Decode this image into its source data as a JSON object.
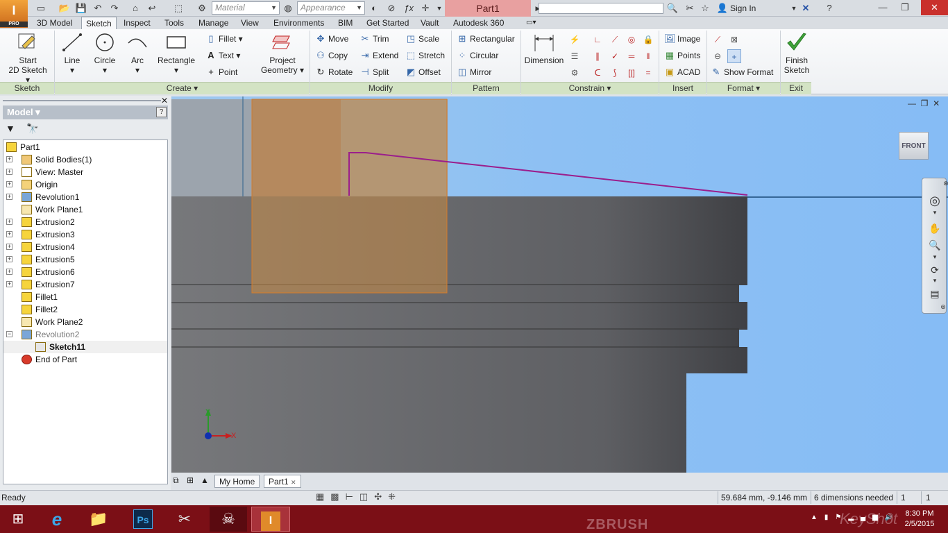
{
  "app": {
    "logo_letter": "I",
    "logo_sub": "PRO",
    "document_title": "Part1",
    "material_placeholder": "Material",
    "appearance_placeholder": "Appearance",
    "sign_in": "Sign In"
  },
  "tabs": [
    "3D Model",
    "Sketch",
    "Inspect",
    "Tools",
    "Manage",
    "View",
    "Environments",
    "BIM",
    "Get Started",
    "Vault",
    "Autodesk 360"
  ],
  "active_tab": "Sketch",
  "ribbon": {
    "sketch": {
      "start_sketch_line1": "Start",
      "start_sketch_line2": "2D Sketch",
      "title": "Sketch"
    },
    "create": {
      "line": "Line",
      "circle": "Circle",
      "arc": "Arc",
      "rectangle": "Rectangle",
      "fillet": "Fillet",
      "text": "Text",
      "point": "Point",
      "project_line1": "Project",
      "project_line2": "Geometry",
      "title": "Create"
    },
    "modify": {
      "move": "Move",
      "copy": "Copy",
      "rotate": "Rotate",
      "trim": "Trim",
      "extend": "Extend",
      "split": "Split",
      "scale": "Scale",
      "stretch": "Stretch",
      "offset": "Offset",
      "title": "Modify"
    },
    "pattern": {
      "rectangular": "Rectangular",
      "circular": "Circular",
      "mirror": "Mirror",
      "title": "Pattern"
    },
    "constrain": {
      "dimension": "Dimension",
      "title": "Constrain"
    },
    "insert": {
      "image": "Image",
      "points": "Points",
      "acad": "ACAD",
      "title": "Insert"
    },
    "format": {
      "show_format": "Show Format",
      "title": "Format"
    },
    "exit": {
      "finish_line1": "Finish",
      "finish_line2": "Sketch",
      "title": "Exit"
    }
  },
  "browser": {
    "header": "Model",
    "tree": [
      {
        "label": "Part1",
        "icon": "part-icon",
        "expand": "",
        "indent": 0
      },
      {
        "label": "Solid Bodies(1)",
        "icon": "solid-bodies-icon",
        "expand": "+",
        "indent": 1
      },
      {
        "label": "View: Master",
        "icon": "view-icon",
        "expand": "+",
        "indent": 1
      },
      {
        "label": "Origin",
        "icon": "folder-icon",
        "expand": "+",
        "indent": 1
      },
      {
        "label": "Revolution1",
        "icon": "revolution-icon",
        "expand": "+",
        "indent": 1
      },
      {
        "label": "Work Plane1",
        "icon": "work-plane-icon",
        "expand": "",
        "indent": 1
      },
      {
        "label": "Extrusion2",
        "icon": "extrusion-icon",
        "expand": "+",
        "indent": 1
      },
      {
        "label": "Extrusion3",
        "icon": "extrusion-icon",
        "expand": "+",
        "indent": 1
      },
      {
        "label": "Extrusion4",
        "icon": "extrusion-icon",
        "expand": "+",
        "indent": 1
      },
      {
        "label": "Extrusion5",
        "icon": "extrusion-icon",
        "expand": "+",
        "indent": 1
      },
      {
        "label": "Extrusion6",
        "icon": "extrusion-icon",
        "expand": "+",
        "indent": 1
      },
      {
        "label": "Extrusion7",
        "icon": "extrusion-icon",
        "expand": "+",
        "indent": 1
      },
      {
        "label": "Fillet1",
        "icon": "fillet-icon",
        "expand": "",
        "indent": 1
      },
      {
        "label": "Fillet2",
        "icon": "fillet-icon",
        "expand": "",
        "indent": 1
      },
      {
        "label": "Work Plane2",
        "icon": "work-plane-icon",
        "expand": "",
        "indent": 1
      },
      {
        "label": "Revolution2",
        "icon": "revolution-icon",
        "expand": "−",
        "indent": 1,
        "dim": true
      },
      {
        "label": "Sketch11",
        "icon": "sketch-icon",
        "expand": "",
        "indent": 2,
        "selected": true
      },
      {
        "label": "End of Part",
        "icon": "end-of-part-icon",
        "expand": "",
        "indent": 1
      }
    ]
  },
  "viewcube_label": "FRONT",
  "axis": {
    "x": "X",
    "y": "Y"
  },
  "doc_tabs": {
    "home": "My Home",
    "part": "Part1"
  },
  "status": {
    "ready": "Ready",
    "coords": "59.684 mm, -9.146 mm",
    "dims_needed": "6 dimensions needed",
    "count1": "1",
    "count2": "1"
  },
  "taskbar": {
    "time": "8:30 PM",
    "date": "2/5/2015",
    "watermark1": "ZBRUSH",
    "watermark2": "KeyShot"
  },
  "colors": {
    "sketch_line": "#9b1e8c",
    "ribbon_panel_title": "#d3e3c4",
    "taskbar": "#7b0f16"
  }
}
